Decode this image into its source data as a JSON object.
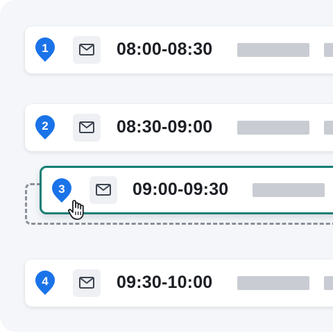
{
  "colors": {
    "pin": "#1a73e8",
    "drag_border": "#157f74",
    "placeholder_bar": "#c9ccd2",
    "dropzone_border": "#8a9099"
  },
  "slots": [
    {
      "number": "1",
      "time": "08:00-08:30",
      "icon": "mail-icon"
    },
    {
      "number": "2",
      "time": "08:30-09:00",
      "icon": "mail-icon"
    },
    {
      "number": "3",
      "time": "09:00-09:30",
      "icon": "mail-icon",
      "state": "dragging"
    },
    {
      "number": "4",
      "time": "09:30-10:00",
      "icon": "mail-icon"
    }
  ],
  "cursor": {
    "icon": "hand-grab-cursor-icon"
  }
}
